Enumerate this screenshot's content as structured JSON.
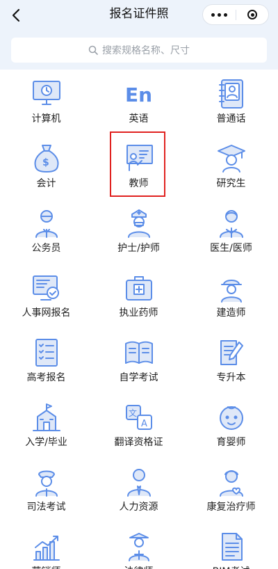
{
  "header": {
    "title": "报名证件照",
    "back_icon": "chevron-left-icon",
    "more_icon": "more-dots-icon",
    "close_icon": "target-close-icon"
  },
  "search": {
    "placeholder": "搜索规格名称、尺寸",
    "icon": "search-icon"
  },
  "accent_color": "#5b8de8",
  "highlight_color": "#e0211f",
  "categories": [
    {
      "label": "计算机",
      "icon": "computer-icon"
    },
    {
      "label": "英语",
      "icon": "en-letters-icon"
    },
    {
      "label": "普通话",
      "icon": "notebook-person-icon"
    },
    {
      "label": "会计",
      "icon": "money-bag-icon"
    },
    {
      "label": "教师",
      "icon": "teacher-board-icon",
      "highlighted": true
    },
    {
      "label": "研究生",
      "icon": "graduate-icon"
    },
    {
      "label": "公务员",
      "icon": "official-icon"
    },
    {
      "label": "护士/护师",
      "icon": "nurse-icon"
    },
    {
      "label": "医生/医师",
      "icon": "doctor-icon"
    },
    {
      "label": "人事网报名",
      "icon": "monitor-check-icon"
    },
    {
      "label": "执业药师",
      "icon": "medical-kit-icon"
    },
    {
      "label": "建造师",
      "icon": "construction-worker-icon"
    },
    {
      "label": "高考报名",
      "icon": "checklist-icon"
    },
    {
      "label": "自学考试",
      "icon": "open-book-icon"
    },
    {
      "label": "专升本",
      "icon": "document-pen-icon"
    },
    {
      "label": "入学/毕业",
      "icon": "school-building-icon"
    },
    {
      "label": "翻译资格证",
      "icon": "translate-icon"
    },
    {
      "label": "育婴师",
      "icon": "baby-face-icon"
    },
    {
      "label": "司法考试",
      "icon": "police-officer-icon"
    },
    {
      "label": "人力资源",
      "icon": "business-person-icon"
    },
    {
      "label": "康复治疗师",
      "icon": "therapist-icon"
    },
    {
      "label": "营销师",
      "icon": "bar-chart-icon"
    },
    {
      "label": "法律师",
      "icon": "lawyer-scales-icon"
    },
    {
      "label": "BIM考试",
      "icon": "document-lines-icon"
    }
  ]
}
